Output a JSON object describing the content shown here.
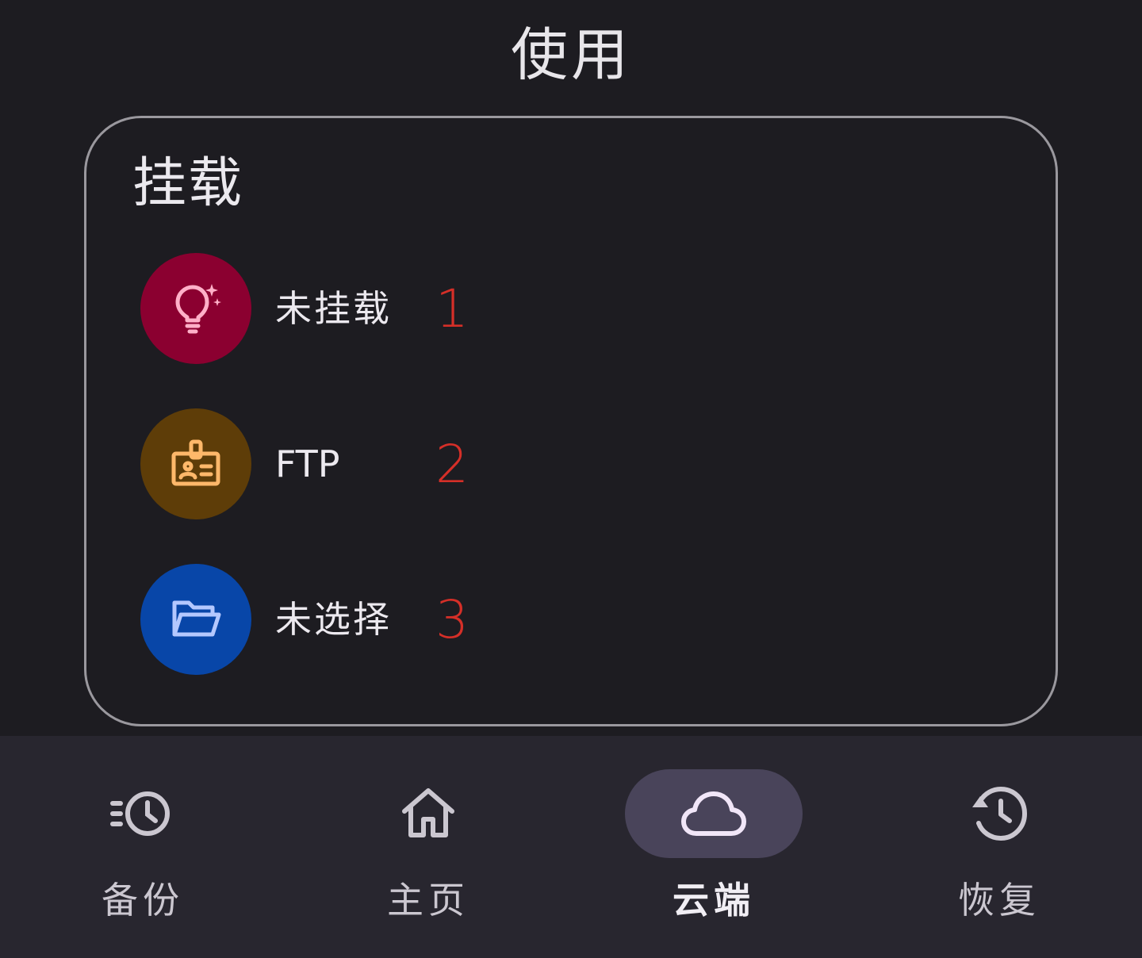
{
  "page": {
    "title": "使用"
  },
  "mount_card": {
    "title": "挂载",
    "items": [
      {
        "label": "未挂载",
        "number": "1",
        "icon": "lightbulb-sparkle-icon",
        "color": "#8b0030",
        "icon_color": "#ffb0c8"
      },
      {
        "label": "FTP",
        "number": "2",
        "icon": "id-badge-icon",
        "color": "#5e3d08",
        "icon_color": "#ffb86a"
      },
      {
        "label": "未选择",
        "number": "3",
        "icon": "folder-open-icon",
        "color": "#0846a8",
        "icon_color": "#b4c8ff"
      }
    ]
  },
  "bottom_nav": {
    "items": [
      {
        "label": "备份",
        "icon": "history-fast-icon"
      },
      {
        "label": "主页",
        "icon": "home-icon"
      },
      {
        "label": "云端",
        "icon": "cloud-icon",
        "active": true
      },
      {
        "label": "恢复",
        "icon": "restore-history-icon"
      }
    ]
  },
  "colors": {
    "background": "#1d1c21",
    "nav_background": "#28262f",
    "active_pill": "#49445a",
    "annotation_red": "#d52f28"
  }
}
